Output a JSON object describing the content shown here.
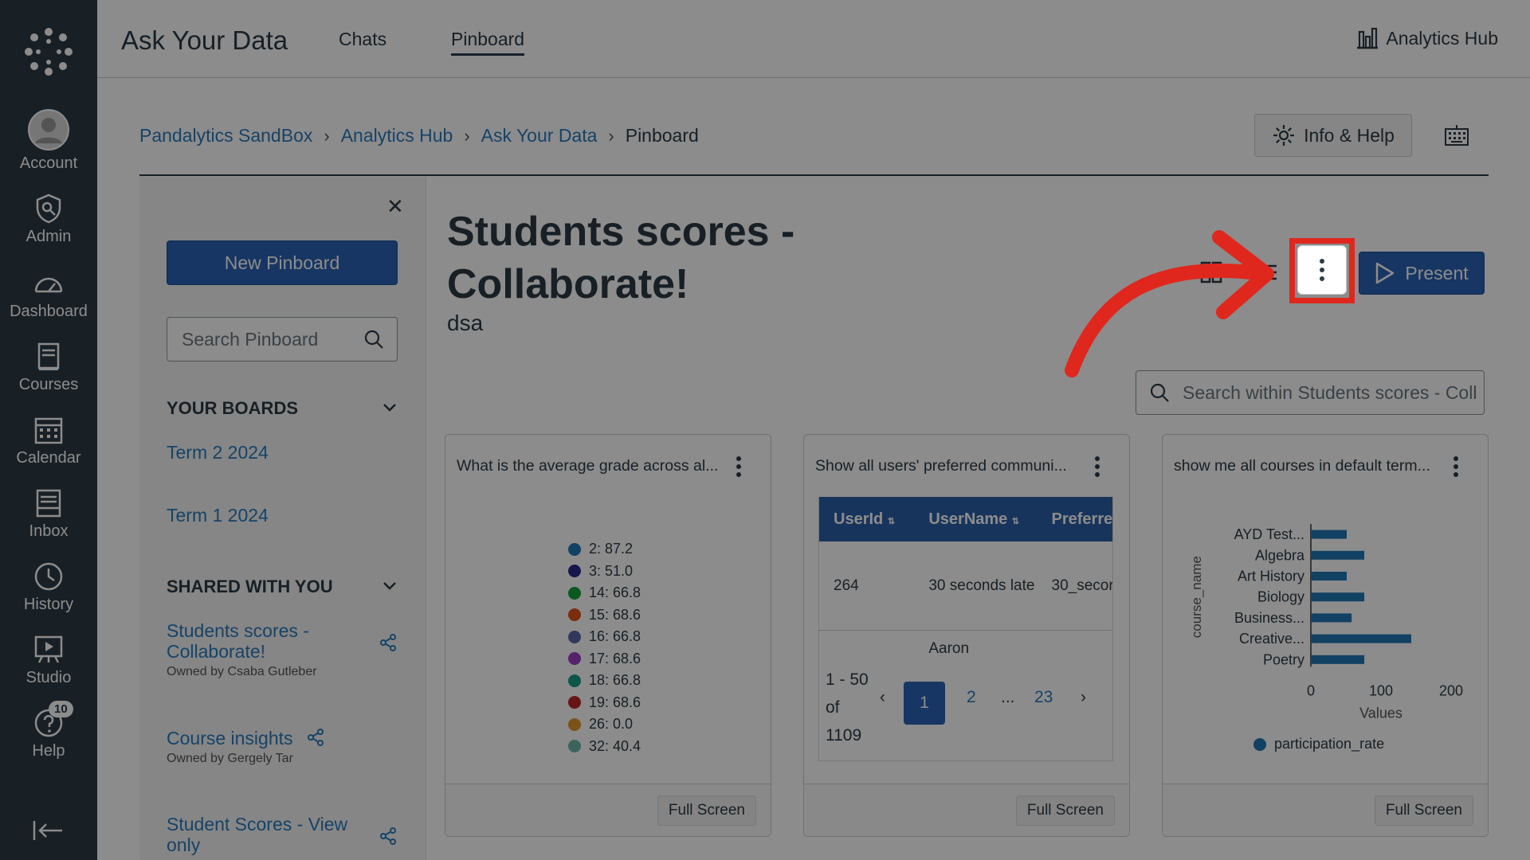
{
  "global_nav": {
    "items": [
      {
        "label": "Account",
        "icon": "account-icon"
      },
      {
        "label": "Admin",
        "icon": "admin-icon"
      },
      {
        "label": "Dashboard",
        "icon": "dashboard-icon"
      },
      {
        "label": "Courses",
        "icon": "courses-icon"
      },
      {
        "label": "Calendar",
        "icon": "calendar-icon"
      },
      {
        "label": "Inbox",
        "icon": "inbox-icon"
      },
      {
        "label": "History",
        "icon": "history-icon"
      },
      {
        "label": "Studio",
        "icon": "studio-icon"
      },
      {
        "label": "Help",
        "icon": "help-icon",
        "badge": "10"
      }
    ]
  },
  "topbar": {
    "app_title": "Ask Your Data",
    "tabs": [
      {
        "label": "Chats"
      },
      {
        "label": "Pinboard",
        "active": true
      }
    ],
    "hub_link": "Analytics Hub"
  },
  "breadcrumb": [
    "Pandalytics SandBox",
    "Analytics Hub",
    "Ask Your Data",
    "Pinboard"
  ],
  "info_help_label": "Info & Help",
  "sidebar": {
    "new_pinboard_label": "New Pinboard",
    "search_placeholder": "Search Pinboard",
    "your_boards_heading": "YOUR BOARDS",
    "your_boards": [
      "Term 2 2024",
      "Term 1 2024"
    ],
    "shared_heading": "SHARED WITH YOU",
    "shared": [
      {
        "title": "Students scores - Collaborate!",
        "owner": "Owned by Csaba Gutleber"
      },
      {
        "title": "Course insights",
        "owner": "Owned by Gergely Tar"
      },
      {
        "title": "Student Scores - View only",
        "owner": ""
      }
    ]
  },
  "board": {
    "title": "Students scores - Collaborate!",
    "description": "dsa",
    "present_label": "Present",
    "search_placeholder": "Search within Students scores - Coll"
  },
  "cards": [
    {
      "title": "What is the average grade across al...",
      "full_screen_label": "Full Screen",
      "legend": [
        {
          "label": "2: 87.2",
          "color": "#1f77b4"
        },
        {
          "label": "3: 51.0",
          "color": "#2a2a8c"
        },
        {
          "label": "14: 66.8",
          "color": "#14a13c"
        },
        {
          "label": "15: 68.6",
          "color": "#e0531d"
        },
        {
          "label": "16: 66.8",
          "color": "#5a6aa8"
        },
        {
          "label": "17: 68.6",
          "color": "#9b3fc4"
        },
        {
          "label": "18: 66.8",
          "color": "#1a9e84"
        },
        {
          "label": "19: 68.6",
          "color": "#c0262b"
        },
        {
          "label": "26: 0.0",
          "color": "#e0952d"
        },
        {
          "label": "32: 40.4",
          "color": "#6fb6a8"
        }
      ]
    },
    {
      "title": "Show all users' preferred communi...",
      "full_screen_label": "Full Screen",
      "columns": [
        "UserId",
        "UserName",
        "Preferre"
      ],
      "rows": [
        [
          "264",
          "30 seconds late",
          "30_secor"
        ],
        [
          "",
          "Aaron",
          ""
        ]
      ],
      "pagination": {
        "info": "1 - 50 of 1109",
        "pages": [
          "1",
          "2",
          "...",
          "23"
        ],
        "current": "1"
      }
    },
    {
      "title": "show me all courses in default term...",
      "full_screen_label": "Full Screen"
    }
  ],
  "chart_data": {
    "type": "bar",
    "orientation": "horizontal",
    "categories": [
      "AYD Test...",
      "Algebra",
      "Art History",
      "Biology",
      "Business...",
      "Creative...",
      "Poetry"
    ],
    "series": [
      {
        "name": "participation_rate",
        "values": [
          50,
          75,
          50,
          75,
          57,
          142,
          75
        ]
      }
    ],
    "xlabel": "Values",
    "ylabel": "course_name",
    "xlim": [
      0,
      200
    ],
    "xticks": [
      "0",
      "100",
      "200"
    ],
    "color": "#1f77b4",
    "legend_position": "bottom"
  }
}
